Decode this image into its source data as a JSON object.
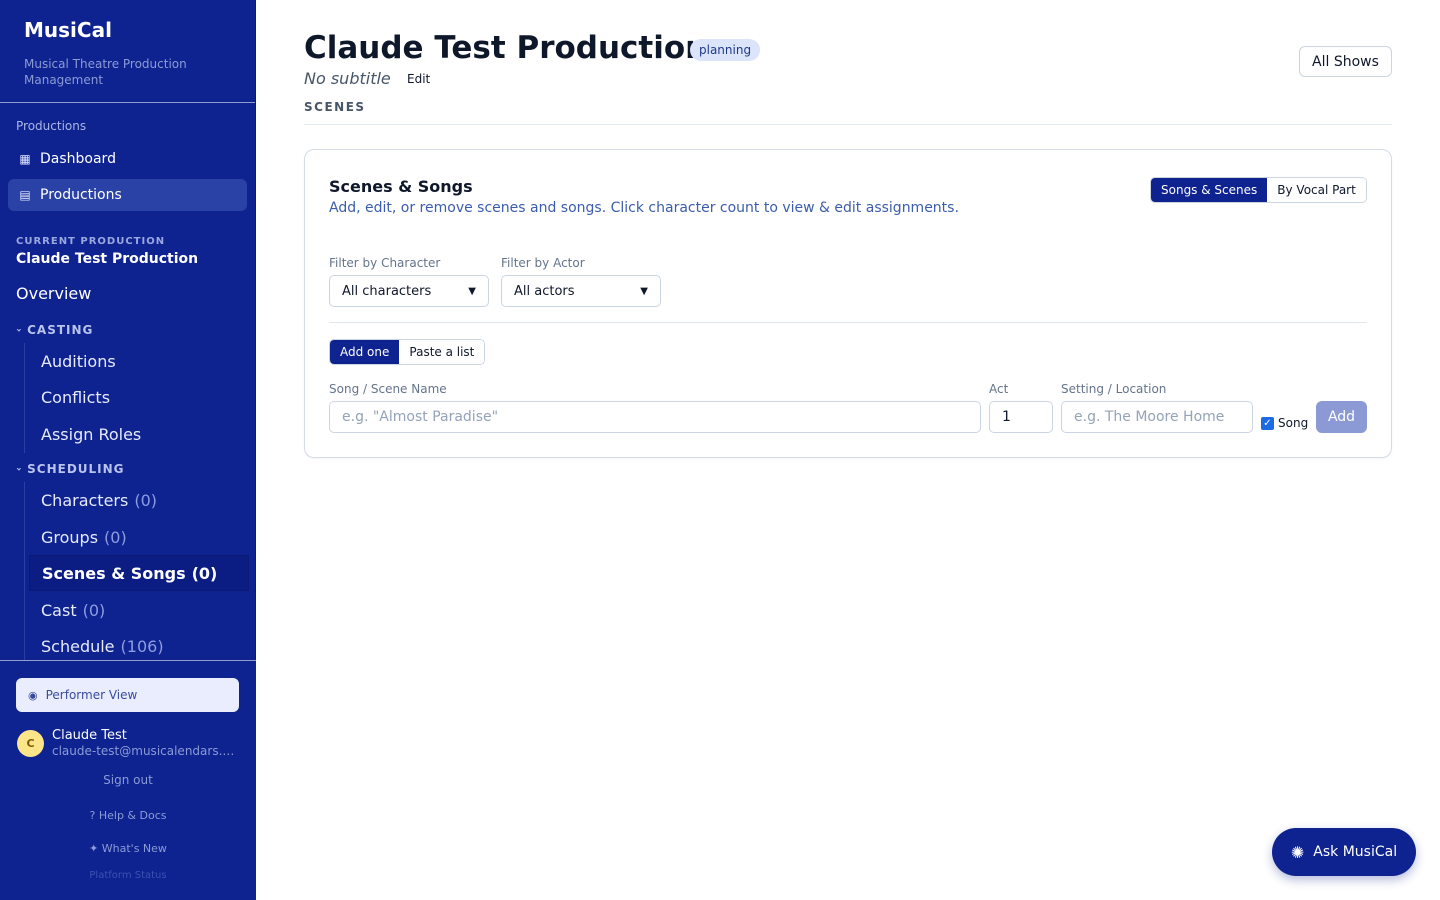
{
  "sidebar": {
    "brand_title": "MusiCal",
    "brand_subtitle": "Musical Theatre Production Management",
    "section_label": "Productions",
    "nav": [
      {
        "label": "Dashboard",
        "icon": "dashboard-icon"
      },
      {
        "label": "Productions",
        "icon": "productions-icon",
        "active": true
      }
    ],
    "current_production_label": "CURRENT PRODUCTION",
    "current_production_name": "Claude Test Production",
    "overview_label": "Overview",
    "casting": {
      "header": "CASTING",
      "items": [
        {
          "label": "Auditions"
        },
        {
          "label": "Conflicts"
        },
        {
          "label": "Assign Roles"
        }
      ]
    },
    "scheduling": {
      "header": "SCHEDULING",
      "items": [
        {
          "label": "Characters",
          "count": "(0)"
        },
        {
          "label": "Groups",
          "count": "(0)"
        },
        {
          "label": "Scenes & Songs",
          "count": "(0)",
          "active": true
        },
        {
          "label": "Cast",
          "count": "(0)"
        },
        {
          "label": "Schedule",
          "count": "(106)"
        }
      ]
    },
    "performer_view_label": "Performer View",
    "user": {
      "initial": "C",
      "name": "Claude Test",
      "email": "claude-test@musicalendars.com"
    },
    "sign_out": "Sign out",
    "help_docs": "Help & Docs",
    "whats_new": "What's New",
    "platform_status": "Platform Status"
  },
  "header": {
    "title": "Claude Test Production",
    "status_badge": "planning",
    "subtitle": "No subtitle",
    "edit_label": "Edit",
    "all_shows_label": "All Shows",
    "section_tab": "SCENES"
  },
  "card": {
    "title": "Scenes & Songs",
    "description": "Add, edit, or remove scenes and songs. Click character count to view & edit assignments.",
    "view_toggle": [
      "Songs & Scenes",
      "By Vocal Part"
    ],
    "filters": {
      "character_label": "Filter by Character",
      "character_value": "All characters",
      "actor_label": "Filter by Actor",
      "actor_value": "All actors"
    },
    "mode_toggle": [
      "Add one",
      "Paste a list"
    ],
    "form": {
      "name_label": "Song / Scene Name",
      "name_placeholder": "e.g. \"Almost Paradise\"",
      "act_label": "Act",
      "act_value": "1",
      "setting_label": "Setting / Location",
      "setting_placeholder": "e.g. The Moore Home",
      "song_checkbox_label": "Song",
      "song_checked": true,
      "add_label": "Add"
    }
  },
  "assistant": {
    "label": "Ask MusiCal"
  },
  "colors": {
    "sidebar_bg": "#0e2290",
    "accent": "#0e2290",
    "badge_bg": "#dbe4fb"
  }
}
